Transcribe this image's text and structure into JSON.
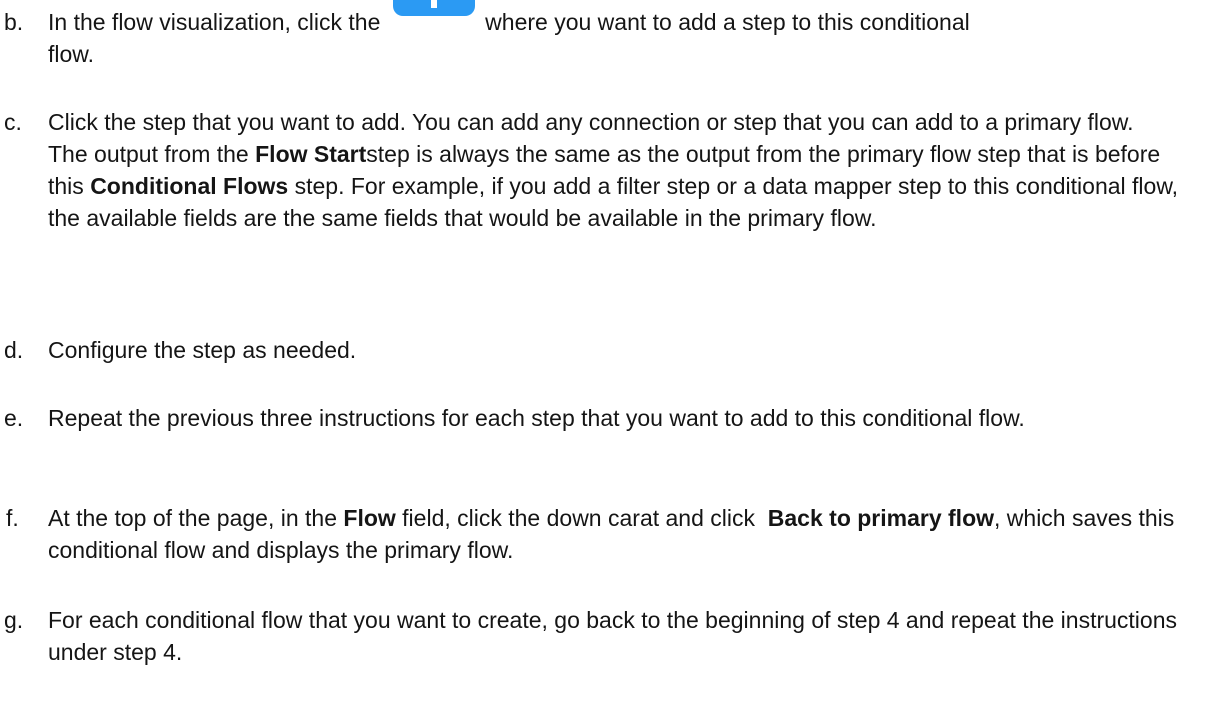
{
  "steps": {
    "b": {
      "marker": "b.",
      "before_icon": "In the flow visualization, click the ",
      "icon": "add-step-plus-icon",
      "after_icon": " where you want to add a step to this conditional",
      "line2": "flow."
    },
    "c": {
      "marker": "c.",
      "p1": "Click the step that you want to add. You can add any connection or step that you can add to a primary flow.",
      "p2_a": "The output from the ",
      "p2_b": "Flow Start",
      "p2_c": "step is always the same as the output from the primary flow step that is before this ",
      "p2_d": "Conditional Flows",
      "p2_e": " step. For example, if you add a filter step or a data mapper step to this conditional flow, the available fields are the same fields that would be available in the primary flow."
    },
    "d": {
      "marker": "d.",
      "text": "Configure the step as needed."
    },
    "e": {
      "marker": "e.",
      "text": "Repeat the previous three instructions for each step that you want to add to this conditional flow."
    },
    "f": {
      "marker": "f.",
      "a": "At the top of the page, in the ",
      "b": "Flow",
      "c": " field, click the down carat and click  ",
      "d": "Back to primary flow",
      "e": ", which saves this conditional flow and displays the primary flow."
    },
    "g": {
      "marker": "g.",
      "text": "For each conditional flow that you want to create, go back to the beginning of step 4 and repeat the instructions under step 4."
    }
  },
  "colors": {
    "text": "#151515",
    "icon_blue": "#2b9af3"
  }
}
